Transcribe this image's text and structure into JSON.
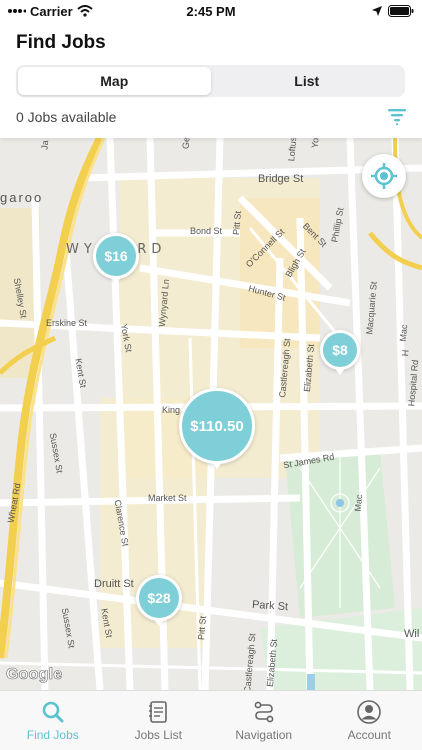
{
  "status_bar": {
    "carrier": "Carrier",
    "time": "2:45 PM"
  },
  "header": {
    "title": "Find Jobs",
    "jobs_available": "0 Jobs available"
  },
  "segmented": {
    "options": [
      {
        "label": "Map",
        "selected": true
      },
      {
        "label": "List",
        "selected": false
      }
    ]
  },
  "map": {
    "district": "WYNYARD",
    "partial_label": "garoo",
    "streets": {
      "bridge": "Bridge St",
      "bond": "Bond St",
      "pitt_top": "Pitt St",
      "oconnell": "O'Connell St",
      "bent": "Bent St",
      "phillip": "Phillip St",
      "hunter": "Hunter St",
      "macquarie": "Macquarie St",
      "erskine": "Erskine St",
      "york": "York St",
      "wynyard_ln": "Wynyard Ln",
      "kent_1": "Kent St",
      "kent_2": "Kent St",
      "castlereagh": "Castlereagh St",
      "castlereagh_2": "Castlereagh St",
      "elizabeth": "Elizabeth St",
      "elizabeth_2": "Elizabeth St",
      "hospital": "Hospital Rd",
      "king": "King",
      "st_james": "St James Rd",
      "market": "Market St",
      "clarence": "Clarence St",
      "sussex_1": "Sussex St",
      "sussex_2": "Sussex St",
      "wheat": "Wheat Rd",
      "druitt": "Druitt St",
      "park": "Park St",
      "pitt_bottom": "Pitt St",
      "shelley": "Shelley St",
      "bligh": "Bligh St",
      "wil": "Wil",
      "loftus": "Loftus",
      "ge": "Ge",
      "ja": "Ja",
      "ja_2": "Ja",
      "yo": "Yo",
      "mac_2": "Mac",
      "h": "H"
    },
    "pins": [
      {
        "label": "$16",
        "amount": 16
      },
      {
        "label": "$8",
        "amount": 8
      },
      {
        "label": "$110.50",
        "amount": 110.5
      },
      {
        "label": "$28",
        "amount": 28
      }
    ],
    "attribution": "Google"
  },
  "tabs": [
    {
      "label": "Find Jobs",
      "icon": "search-icon",
      "active": true
    },
    {
      "label": "Jobs List",
      "icon": "notepad-icon",
      "active": false
    },
    {
      "label": "Navigation",
      "icon": "route-icon",
      "active": false
    },
    {
      "label": "Account",
      "icon": "person-icon",
      "active": false
    }
  ],
  "colors": {
    "accent": "#5bc3d0",
    "pin": "#7fcfd8",
    "highway": "#f4d35e",
    "park": "#d8ecd8",
    "block": "#fbeec8"
  }
}
